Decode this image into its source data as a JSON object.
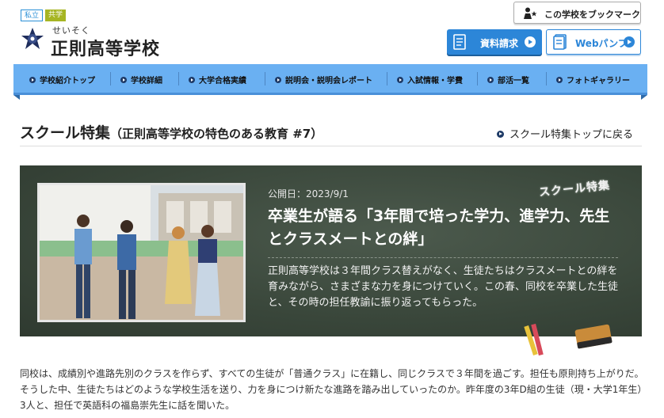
{
  "header": {
    "tags": [
      "私立",
      "共学"
    ],
    "school_ruby": "せいそく",
    "school_name": "正則高等学校",
    "bookmark_label": "この学校をブックマーク",
    "doc_request_label": "資料請求",
    "web_pamphlet_label": "Webパンフ"
  },
  "nav": {
    "items": [
      "学校紹介トップ",
      "学校詳細",
      "大学合格実績",
      "説明会・説明会レポート",
      "入試情報・学費",
      "部活一覧",
      "フォトギャラリー"
    ]
  },
  "section": {
    "title": "スクール特集",
    "subtitle": "（正則高等学校の特色のある教育 #7）",
    "back_link": "スクール特集トップに戻る"
  },
  "feature": {
    "date": "公開日：2023/9/1",
    "title": "卒業生が語る「3年間で培った学力、進学力、先生とクラスメートとの絆」",
    "description": "正則高等学校は３年間クラス替えがなく、生徒たちはクラスメートとの絆を育みながら、さまざまな力を身につけていく。この春、同校を卒業した生徒と、その時の担任教諭に振り返ってもらった。",
    "chalk_label": "スクール特集"
  },
  "body": {
    "text": "同校は、成績別や進路先別のクラスを作らず、すべての生徒が「普通クラス」に在籍し、同じクラスで３年間を過ごす。担任も原則持ち上がりだ。そうした中、生徒たちはどのような学校生活を送り、力を身につけ新たな進路を踏み出していったのか。昨年度の3年D組の生徒（現・大学1年生）3人と、担任で英語科の福島崇先生に話を聞いた。"
  },
  "colors": {
    "accent_blue": "#2c86d8",
    "nav_bg": "#6ab0f2",
    "board_bg": "#39463a",
    "tag_coed": "#a6b523"
  },
  "icons": [
    "school-emblem-icon",
    "bookmark-person-icon",
    "document-icon",
    "pamphlet-icon",
    "arrow-right-icon"
  ]
}
